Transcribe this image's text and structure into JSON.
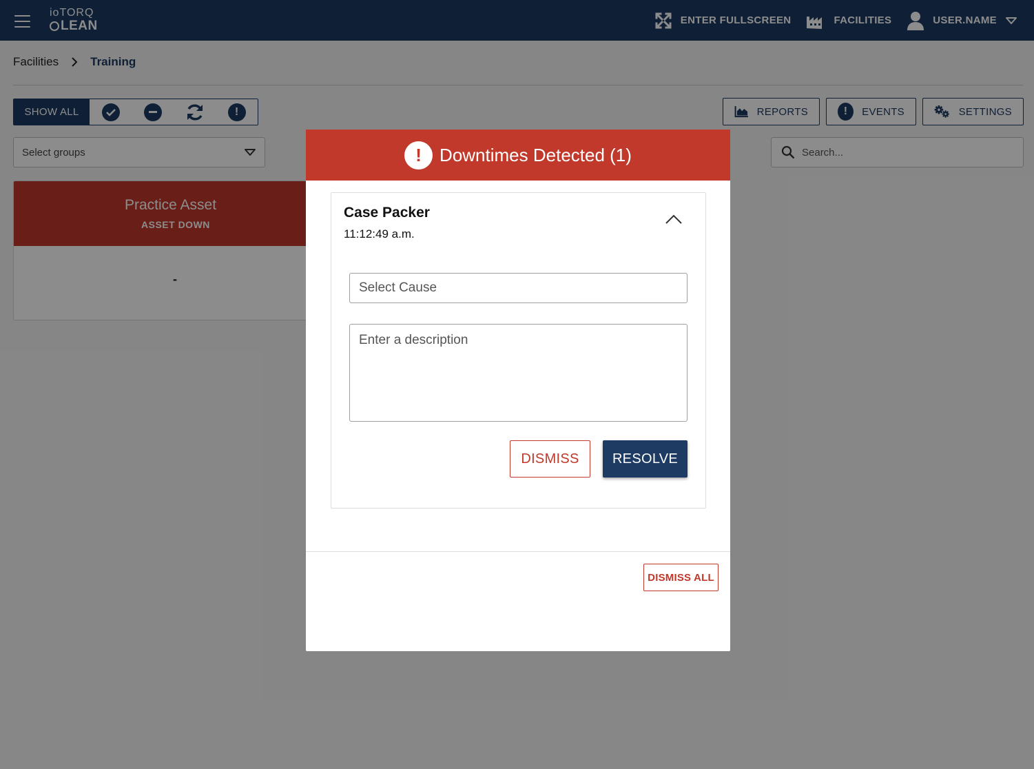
{
  "header": {
    "logo_line1": "ioTORQ",
    "logo_line2": "LEAN",
    "fullscreen_label": "ENTER FULLSCREEN",
    "facilities_label": "FACILITIES",
    "user_label": "USER.NAME",
    "icons": [
      "menu-icon",
      "fullscreen-icon",
      "factory-icon",
      "user-icon",
      "chevron-down-icon"
    ]
  },
  "breadcrumb": {
    "items": [
      "Facilities",
      "Training"
    ]
  },
  "filters": {
    "show_all_label": "SHOW ALL",
    "icons": [
      "check-circle-icon",
      "minus-circle-icon",
      "refresh-icon",
      "alert-circle-icon"
    ]
  },
  "actions": {
    "reports_label": "REPORTS",
    "events_label": "EVENTS",
    "settings_label": "SETTINGS"
  },
  "select_groups": {
    "placeholder": "Select groups"
  },
  "search": {
    "placeholder": "Search..."
  },
  "asset_card": {
    "name": "Practice Asset",
    "status": "ASSET DOWN",
    "value": "-"
  },
  "modal": {
    "title": "Downtimes Detected (1)",
    "downtime": {
      "asset_name": "Case Packer",
      "time": "11:12:49 a.m.",
      "cause_placeholder": "Select Cause",
      "description_placeholder": "Enter a description"
    },
    "dismiss_label": "DISMISS",
    "resolve_label": "RESOLVE",
    "dismiss_all_label": "DISMISS ALL"
  },
  "colors": {
    "navy": "#1d3b63",
    "alert_red": "#c0392b",
    "overlay": "rgba(0,0,0,0.45)"
  }
}
